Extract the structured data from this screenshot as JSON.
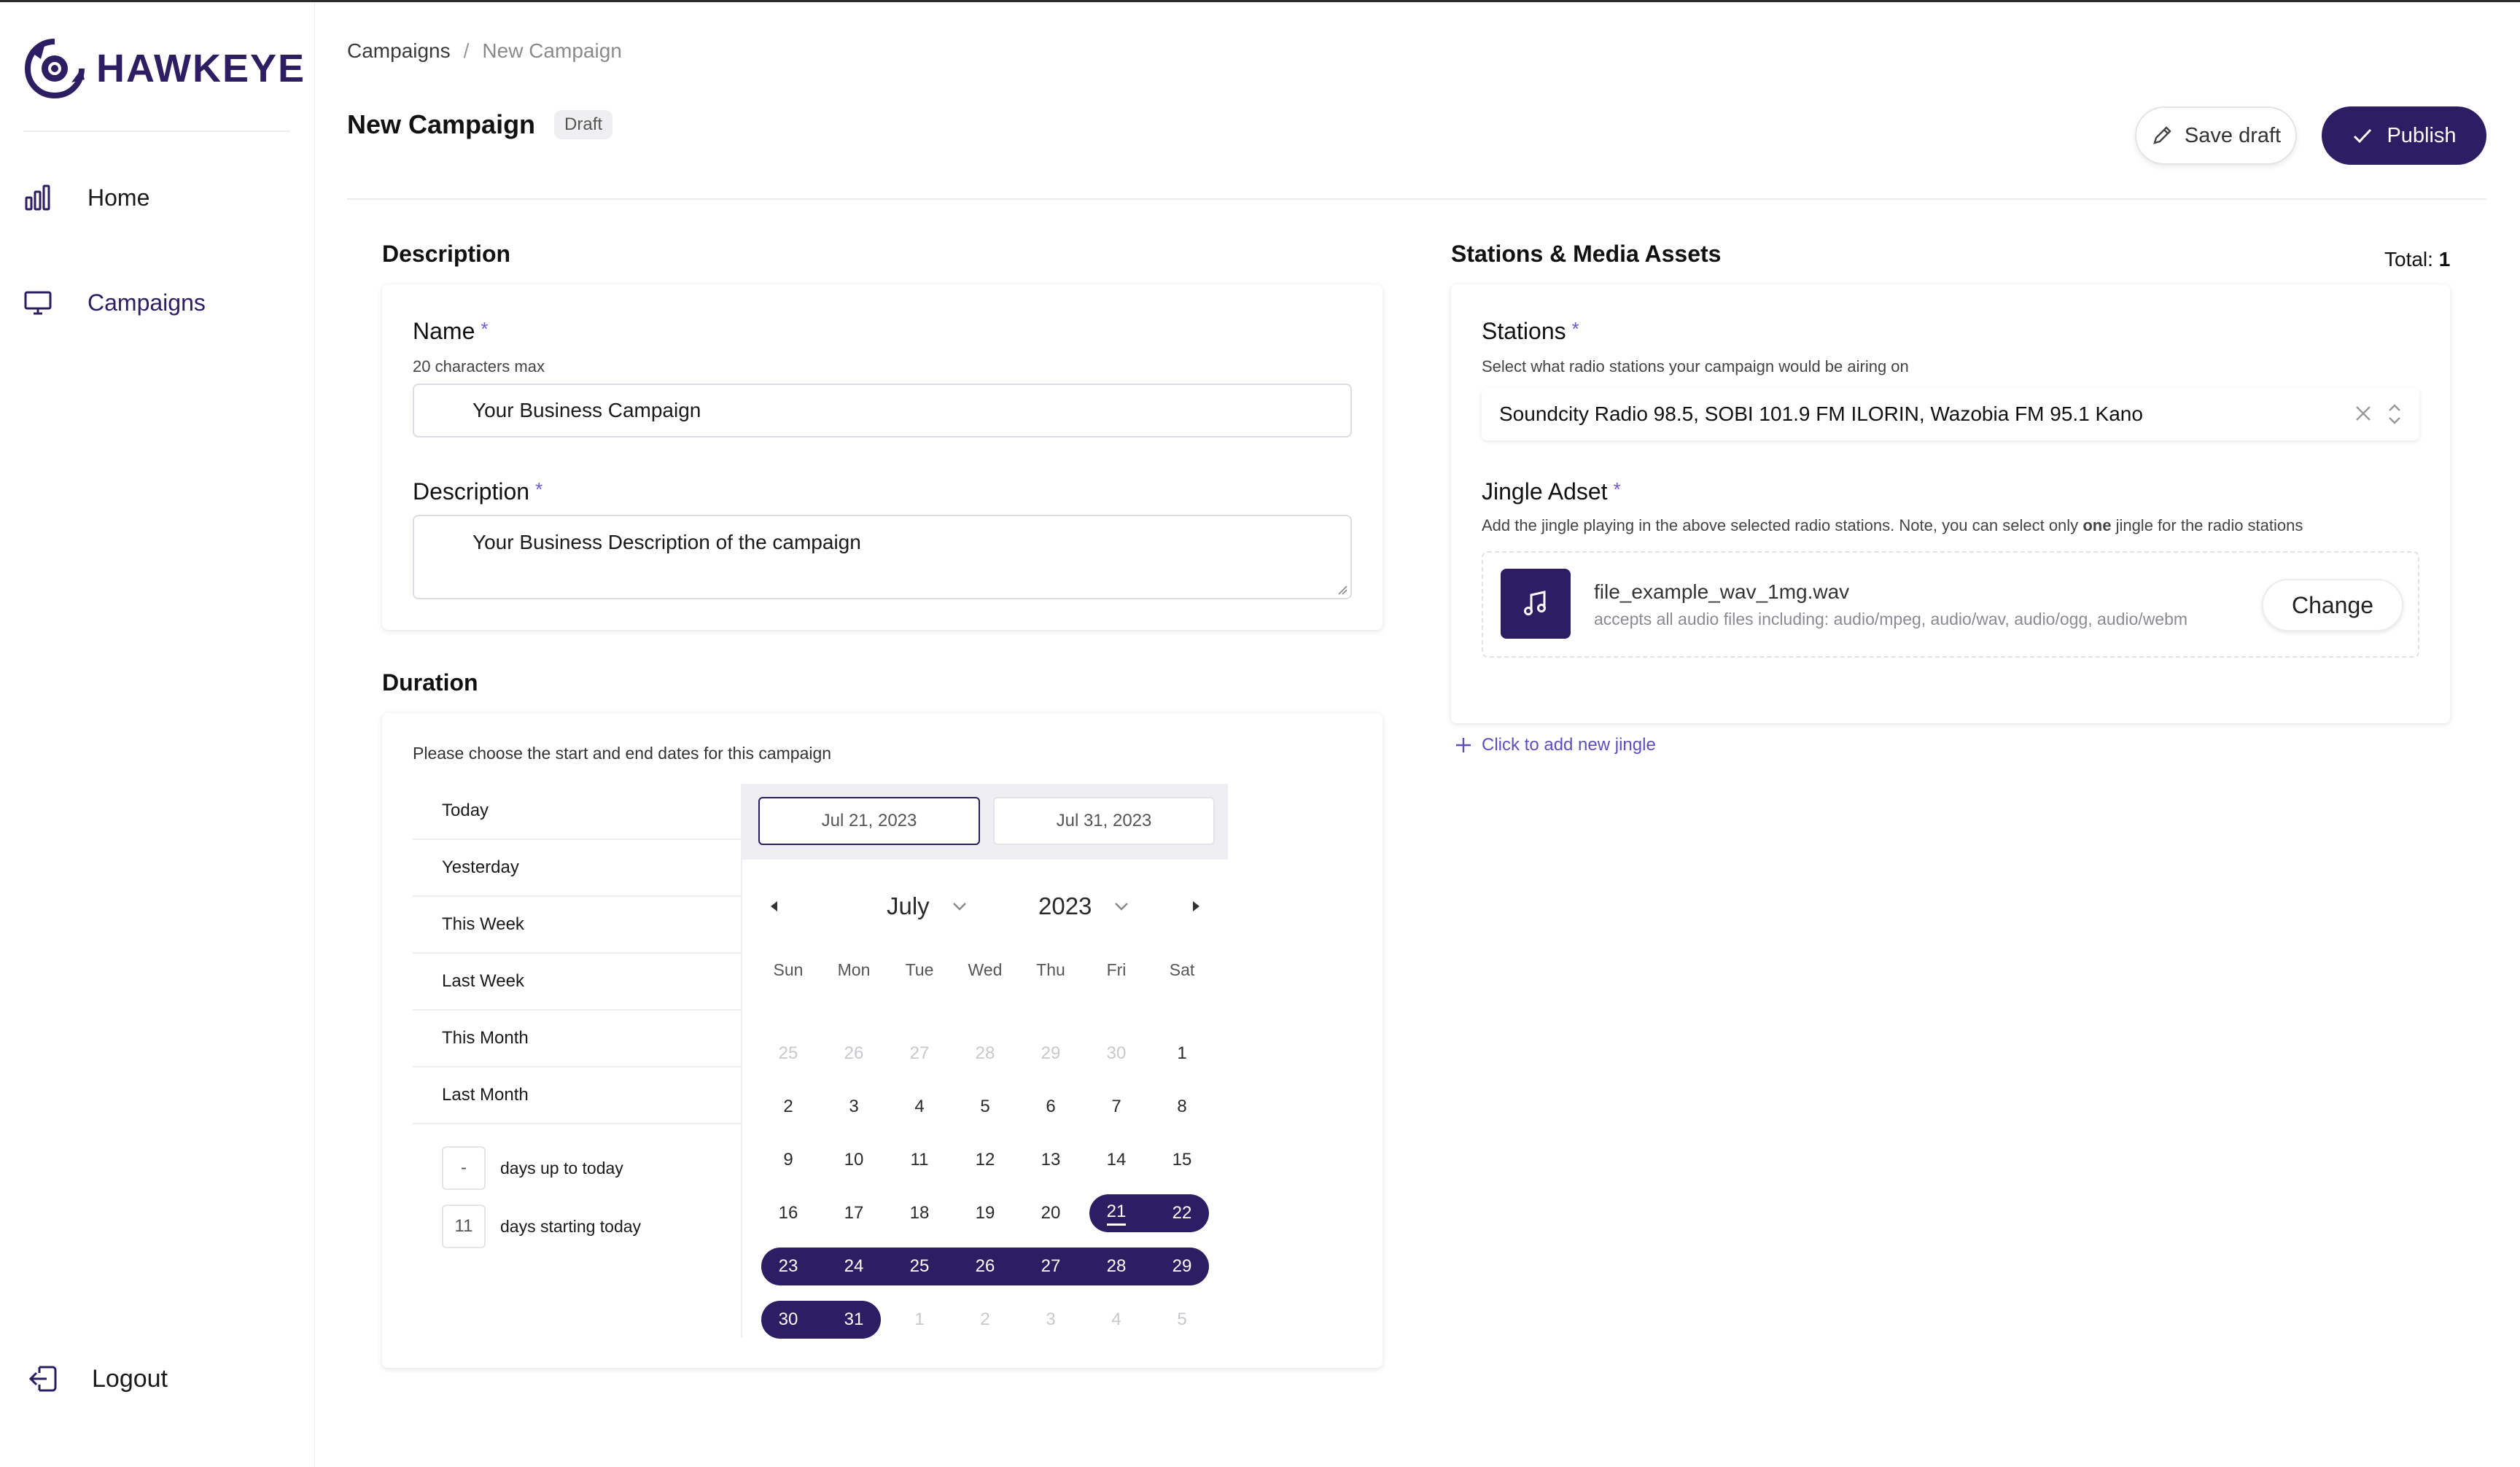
{
  "app": {
    "name": "HAWKEYE",
    "brand_color": "#2d1d63",
    "accent_color": "#6b5bd0"
  },
  "sidebar": {
    "items": [
      {
        "label": "Home",
        "icon": "bar-chart-icon"
      },
      {
        "label": "Campaigns",
        "icon": "monitor-icon"
      }
    ],
    "logout": {
      "label": "Logout",
      "icon": "logout-icon"
    }
  },
  "breadcrumb": {
    "parent": "Campaigns",
    "separator": "/",
    "current": "New Campaign"
  },
  "page": {
    "title": "New Campaign",
    "badge": "Draft",
    "save_draft_label": "Save draft",
    "publish_label": "Publish"
  },
  "description_section": {
    "title": "Description",
    "name": {
      "label": "Name",
      "required": "*",
      "hint": "20 characters max",
      "value": "Your Business Campaign"
    },
    "description": {
      "label": "Description",
      "required": "*",
      "value": "Your Business Description of the campaign"
    }
  },
  "duration": {
    "title": "Duration",
    "hint": "Please choose the start and end dates for this campaign",
    "presets": [
      "Today",
      "Yesterday",
      "This Week",
      "Last Week",
      "This Month",
      "Last Month"
    ],
    "days_up_to_today": {
      "value": "-",
      "label": "days up to today"
    },
    "days_starting_today": {
      "value": "11",
      "label": "days starting today"
    },
    "start_date": "Jul 21, 2023",
    "end_date": "Jul 31, 2023",
    "calendar": {
      "month": "July",
      "year": "2023",
      "weekdays": [
        "Sun",
        "Mon",
        "Tue",
        "Wed",
        "Thu",
        "Fri",
        "Sat"
      ],
      "weeks": [
        [
          "25",
          "26",
          "27",
          "28",
          "29",
          "30",
          "1"
        ],
        [
          "2",
          "3",
          "4",
          "5",
          "6",
          "7",
          "8"
        ],
        [
          "9",
          "10",
          "11",
          "12",
          "13",
          "14",
          "15"
        ],
        [
          "16",
          "17",
          "18",
          "19",
          "20",
          "21",
          "22"
        ],
        [
          "23",
          "24",
          "25",
          "26",
          "27",
          "28",
          "29"
        ],
        [
          "30",
          "31",
          "1",
          "2",
          "3",
          "4",
          "5"
        ]
      ],
      "selected_range": {
        "start": 21,
        "end": 31
      }
    }
  },
  "stations_section": {
    "title": "Stations & Media Assets",
    "total_label": "Total:",
    "total_value": "1",
    "stations": {
      "label": "Stations",
      "required": "*",
      "hint": "Select what radio stations your campaign would be airing on",
      "value": "Soundcity Radio 98.5, SOBI 101.9 FM ILORIN, Wazobia FM 95.1 Kano"
    },
    "jingle": {
      "label": "Jingle Adset",
      "required": "*",
      "hint_before": "Add the jingle playing in the above selected radio stations. Note, you can select only",
      "hint_bold": "one",
      "hint_after": "jingle for the radio stations",
      "file_name": "file_example_wav_1mg.wav",
      "accepts": "accepts all audio files including: audio/mpeg, audio/wav, audio/ogg, audio/webm",
      "change_label": "Change"
    },
    "add_jingle_label": "Click to add new jingle"
  }
}
